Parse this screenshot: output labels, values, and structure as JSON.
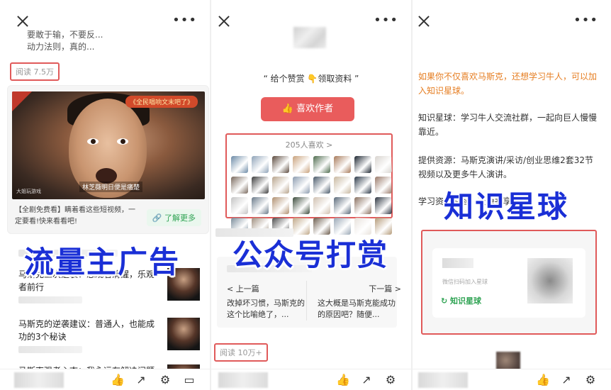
{
  "panel1": {
    "prev_titles": [
      "要敢于输，不要反...",
      "动力法则，真的..."
    ],
    "read_count": "阅读 7.5万",
    "ad": {
      "banner": "《全民唱响文末吧了》",
      "subtitle": "林芝薇明日便是痛楚",
      "logo": "大姐玩游戏",
      "text": "【全剧免费看】瞒着看这些短视频，一定要看!快来看看吧!",
      "button": "了解更多"
    },
    "overlay": "流量主广告",
    "articles": [
      {
        "title": "马斯克三次逆袭：思观者清醒，乐观者前行"
      },
      {
        "title": "马斯克的逆袭建议：普通人，也能成功的3个秘诀"
      },
      {
        "title": "马斯克强者心态：我永远有解决问题"
      }
    ]
  },
  "panel2": {
    "slogan": "“ 给个赞赏 👇领取资料 ”",
    "like_button": "喜欢作者",
    "likes_count": "205人喜欢 >",
    "overlay": "公众号打赏",
    "prev_label": "< 上一篇",
    "prev_text": "改掉坏习惯，马斯克的这个比喻绝了，...",
    "next_label": "下一篇 >",
    "next_text": "这大概是马斯克能成功的原因吧？随便...",
    "read_count": "阅读 10万+"
  },
  "panel3": {
    "para1": "如果你不仅喜欢马斯克，还想学习牛人，可以加入知识星球。",
    "para2": "知识星球：学习牛人交流社群，一起向巨人慢慢靠近。",
    "para3": "提供资源：马斯克演讲/采访/创业思维2套32节视频以及更多牛人演讲。",
    "para4": "学习资...经验、资源共享...",
    "overlay": "知识星球",
    "scan_text": "微信扫码加入星球",
    "tag": "知识星球"
  },
  "colors": {
    "accent_red": "#e95c5c",
    "highlight_border": "#e05a5a",
    "overlay_blue": "#1a2fd6",
    "orange": "#e67e22",
    "green": "#2fa353"
  },
  "avatar_colors": [
    "#6b8aa6",
    "#8fa3b8",
    "#5c4a3d",
    "#c9a27c",
    "#4d6b4d",
    "#a87a5a",
    "#1c2530",
    "#d8d4cf",
    "#7a6a5e",
    "#3d3d3d",
    "#b8a48c",
    "#8c9cb0",
    "#4a5a6a",
    "#c8b8a0",
    "#2e3b4a",
    "#9a7a6a",
    "#c4c4c4",
    "#6a7a8a",
    "#b09070",
    "#3a4a3a",
    "#d0c0b0",
    "#5a6a7a",
    "#8a7060",
    "#2c3440",
    "#7a8c9a",
    "#a09080",
    "#4c4c4c",
    "#c0a888",
    "#6c5c4c",
    "#9aa8b6",
    "#e8e2dc",
    "#b49a78"
  ]
}
